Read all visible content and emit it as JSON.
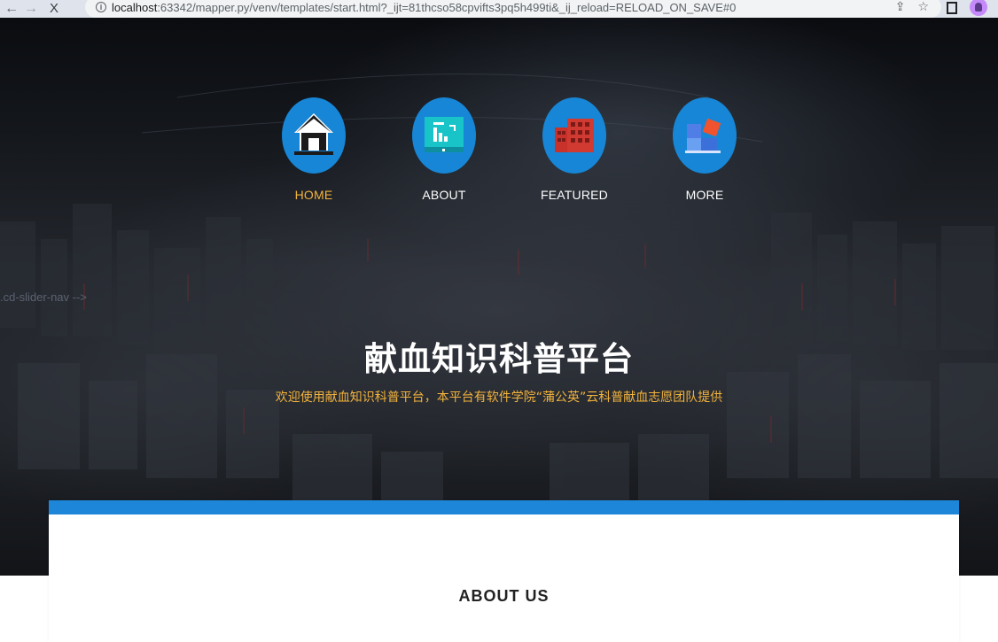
{
  "browser": {
    "url_host": "localhost",
    "url_rest": ":63342/mapper.py/venv/templates/start.html?_ijt=81thcso58cpvifts3pq5h499ti&_ij_reload=RELOAD_ON_SAVE#0",
    "back_glyph": "←",
    "forward_glyph": "→",
    "stop_glyph": "X",
    "share_glyph": "⇪",
    "star_glyph": "☆",
    "info_glyph": "i"
  },
  "nav": {
    "items": [
      {
        "label": "HOME",
        "icon": "home-icon",
        "active": true
      },
      {
        "label": "ABOUT",
        "icon": "monitor-chart-icon",
        "active": false
      },
      {
        "label": "FEATURED",
        "icon": "building-icon",
        "active": false
      },
      {
        "label": "MORE",
        "icon": "blocks-icon",
        "active": false
      }
    ]
  },
  "hero": {
    "comment_text": ".cd-slider-nav -->",
    "title": "献血知识科普平台",
    "subtitle": "欢迎使用献血知识科普平台，本平台有软件学院“蒲公英”云科普献血志愿团队提供"
  },
  "about": {
    "title": "ABOUT US"
  },
  "colors": {
    "accent_blue": "#1786d6",
    "active_yellow": "#f2b33d",
    "card_border_blue": "#1e86d8"
  }
}
